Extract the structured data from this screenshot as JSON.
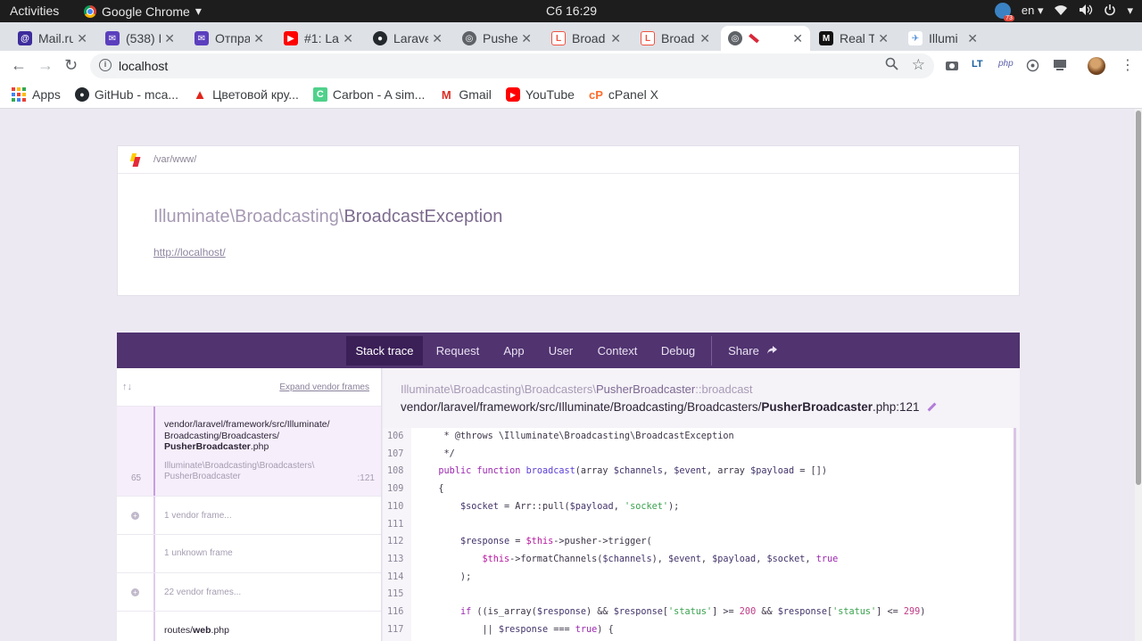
{
  "topbar": {
    "activities": "Activities",
    "app_name": "Google Chrome",
    "clock": "Сб 16:29",
    "badge_count": "73",
    "lang": "en"
  },
  "tabs": [
    {
      "title": "Mail.ru",
      "favicon": "mailru-icon",
      "color": "#3d2d9c"
    },
    {
      "title": "(538) E",
      "favicon": "mail-icon",
      "color": "#5b3fbe"
    },
    {
      "title": "Отпра",
      "favicon": "mail-icon",
      "color": "#5b3fbe"
    },
    {
      "title": "#1: La",
      "favicon": "youtube-icon",
      "color": "#ff0000"
    },
    {
      "title": "Larave",
      "favicon": "github-icon",
      "color": "#24292e"
    },
    {
      "title": "Pushe",
      "favicon": "globe-icon",
      "color": "#5f6368"
    },
    {
      "title": "Broad",
      "favicon": "laravel-icon",
      "color": "#f05340"
    },
    {
      "title": "Broad",
      "favicon": "laravel-icon",
      "color": "#f05340"
    },
    {
      "title": "",
      "favicon": "globe-icon",
      "color": "#5f6368",
      "active": true
    },
    {
      "title": "Real T",
      "favicon": "medium-icon",
      "color": "#111111"
    },
    {
      "title": "Illumi",
      "favicon": "telegram-icon",
      "color": "#4a8ad8"
    }
  ],
  "toolbar": {
    "url": "localhost",
    "ext_lt": "LT",
    "ext_php": "php"
  },
  "bookmarks": [
    {
      "label": "Apps",
      "icon": "apps-grid-icon"
    },
    {
      "label": "GitHub - mca...",
      "icon": "github-icon"
    },
    {
      "label": "Цветовой кру...",
      "icon": "adobe-icon"
    },
    {
      "label": "Carbon - A sim...",
      "icon": "carbon-icon"
    },
    {
      "label": "Gmail",
      "icon": "gmail-icon"
    },
    {
      "label": "YouTube",
      "icon": "youtube-icon"
    },
    {
      "label": "cPanel X",
      "icon": "cpanel-icon"
    }
  ],
  "header": {
    "path": "/var/www/",
    "exception_ns": "Illuminate\\Broadcasting\\",
    "exception_name": "BroadcastException",
    "url": "http://localhost/"
  },
  "nav": {
    "items": [
      "Stack trace",
      "Request",
      "App",
      "User",
      "Context",
      "Debug"
    ],
    "share": "Share",
    "active": "Stack trace"
  },
  "stack": {
    "arrows": "↑↓",
    "expand_label": "Expand vendor frames",
    "selected_frame": {
      "number": "65",
      "path_line1": "vendor/laravel/framework/src/Illuminate/",
      "path_line2": "Broadcasting/Broadcasters/",
      "file_bold": "PusherBroadcaster",
      "file_ext": ".php",
      "class_line1": "Illuminate\\Broadcasting\\Broadcasters\\",
      "class_line2": "PusherBroadcaster",
      "line": ":121"
    },
    "vendor_1": "1 vendor frame...",
    "unknown_1": "1 unknown frame",
    "vendor_22": "22 vendor frames...",
    "routes_prefix": "routes/",
    "routes_bold": "web",
    "routes_ext": ".php"
  },
  "code": {
    "class_ns": "Illuminate\\Broadcasting\\Broadcasters\\",
    "class_name": "PusherBroadcaster",
    "method": "::broadcast",
    "file_prefix": "vendor/laravel/framework/src/Illuminate/Broadcasting/Broadcasters/",
    "file_bold": "PusherBroadcaster",
    "file_suffix": ".php:121",
    "line_numbers": [
      "106",
      "107",
      "108",
      "109",
      "110",
      "111",
      "112",
      "113",
      "114",
      "115",
      "116",
      "117"
    ]
  }
}
